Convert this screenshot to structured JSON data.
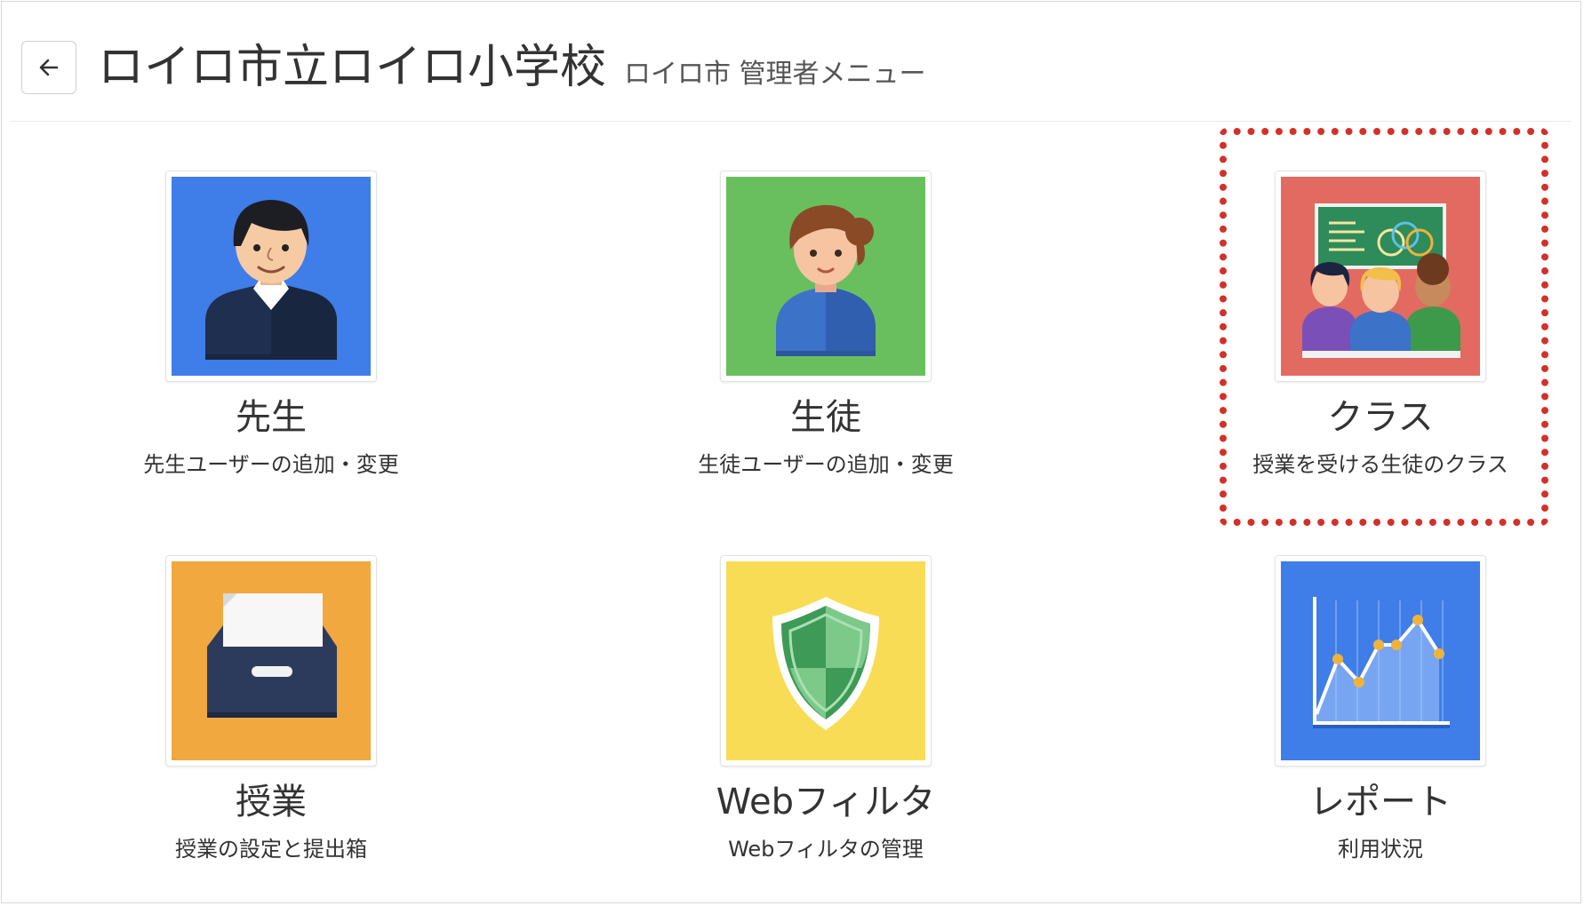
{
  "header": {
    "back_label": "←",
    "title": "ロイロ市立ロイロ小学校",
    "subtitle": "ロイロ市 管理者メニュー"
  },
  "tiles": [
    {
      "label": "先生",
      "desc": "先生ユーザーの追加・変更",
      "icon": "teacher-icon",
      "color": "#3f7de8"
    },
    {
      "label": "生徒",
      "desc": "生徒ユーザーの追加・変更",
      "icon": "student-icon",
      "color": "#69bf5e"
    },
    {
      "label": "クラス",
      "desc": "授業を受ける生徒のクラス",
      "icon": "class-icon",
      "color": "#e26a60"
    },
    {
      "label": "授業",
      "desc": "授業の設定と提出箱",
      "icon": "archive-box-icon",
      "color": "#f0a83f"
    },
    {
      "label": "Webフィルタ",
      "desc": "Webフィルタの管理",
      "icon": "shield-icon",
      "color": "#f9dc55"
    },
    {
      "label": "レポート",
      "desc": "利用状況",
      "icon": "line-chart-icon",
      "color": "#3f7de8"
    }
  ],
  "highlight_color": "#d2312a"
}
